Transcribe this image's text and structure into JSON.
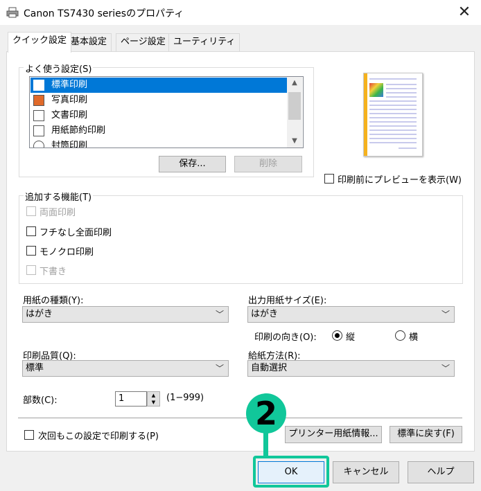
{
  "window": {
    "title": "Canon TS7430 seriesのプロパティ",
    "close_glyph": "✕"
  },
  "tabs": [
    {
      "label": "クイック設定",
      "active": true
    },
    {
      "label": "基本設定",
      "active": false
    },
    {
      "label": "ページ設定",
      "active": false
    },
    {
      "label": "ユーティリティ",
      "active": false
    }
  ],
  "presets": {
    "legend": "よく使う設定(S)",
    "items": [
      {
        "label": "標準印刷",
        "selected": true
      },
      {
        "label": "写真印刷",
        "selected": false
      },
      {
        "label": "文書印刷",
        "selected": false
      },
      {
        "label": "用紙節約印刷",
        "selected": false
      },
      {
        "label": "封筒印刷",
        "selected": false
      }
    ],
    "save_button": "保存...",
    "delete_button": "削除"
  },
  "preview_option": {
    "label": "印刷前にプレビューを表示(W)",
    "checked": false
  },
  "features": {
    "legend": "追加する機能(T)",
    "items": [
      {
        "label": "両面印刷",
        "checked": false,
        "enabled": false
      },
      {
        "label": "フチなし全面印刷",
        "checked": false,
        "enabled": true
      },
      {
        "label": "モノクロ印刷",
        "checked": false,
        "enabled": true
      },
      {
        "label": "下書き",
        "checked": false,
        "enabled": false
      }
    ]
  },
  "media_type": {
    "label": "用紙の種類(Y):",
    "value": "はがき"
  },
  "output_size": {
    "label": "出力用紙サイズ(E):",
    "value": "はがき"
  },
  "orientation": {
    "label": "印刷の向き(O):",
    "portrait": "縦",
    "landscape": "横",
    "selected": "portrait"
  },
  "print_quality": {
    "label": "印刷品質(Q):",
    "value": "標準"
  },
  "paper_source": {
    "label": "給紙方法(R):",
    "value": "自動選択"
  },
  "copies": {
    "label": "部数(C):",
    "value": "1",
    "range": "(1−999)"
  },
  "always_print": {
    "label": "次回もこの設定で印刷する(P)",
    "checked": false
  },
  "printer_media_info_button": "プリンター用紙情報...",
  "defaults_button": "標準に戻す(F)",
  "footer": {
    "ok": "OK",
    "cancel": "キャンセル",
    "help": "ヘルプ"
  },
  "annotation": {
    "step_number": "2",
    "color": "#11c79a"
  },
  "colors": {
    "selection": "#0078d7",
    "accent_annotation": "#11c79a",
    "preview_edge": "#f5b21e"
  }
}
